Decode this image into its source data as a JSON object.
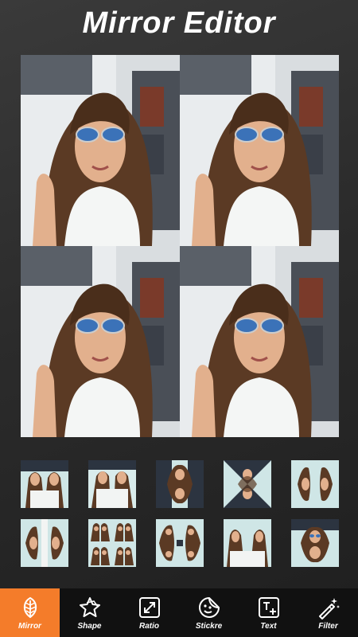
{
  "app": {
    "title": "Mirror Editor"
  },
  "toolbar": {
    "items": [
      {
        "label": "Mirror",
        "icon": "mirror-leaf-icon",
        "active": true
      },
      {
        "label": "Shape",
        "icon": "star-shape-icon",
        "active": false
      },
      {
        "label": "Ratio",
        "icon": "ratio-resize-icon",
        "active": false
      },
      {
        "label": "Stickre",
        "icon": "sticker-face-icon",
        "active": false
      },
      {
        "label": "Text",
        "icon": "text-add-icon",
        "active": false
      },
      {
        "label": "Filter",
        "icon": "magic-wand-icon",
        "active": false
      }
    ]
  },
  "mirror_layouts": {
    "count": 10
  },
  "colors": {
    "accent": "#f47c2a",
    "toolbar_bg": "#111111",
    "background": "#2a2a2a"
  }
}
